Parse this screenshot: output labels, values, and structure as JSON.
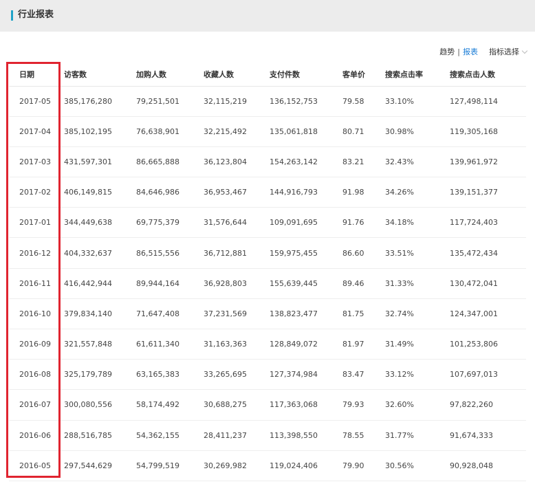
{
  "header": {
    "title": "行业报表"
  },
  "toolbar": {
    "trend_label": "趋势",
    "separator": "|",
    "report_label": "报表",
    "metric_select_label": "指标选择"
  },
  "colors": {
    "accent": "#1fa3c8",
    "link": "#1a7cd6",
    "highlight": "#e02430",
    "header_bg": "#ececec"
  },
  "table": {
    "columns": [
      "日期",
      "访客数",
      "加购人数",
      "收藏人数",
      "支付件数",
      "客单价",
      "搜索点击率",
      "搜索点击人数"
    ],
    "rows": [
      [
        "2017-05",
        "385,176,280",
        "79,251,501",
        "32,115,219",
        "136,152,753",
        "79.58",
        "33.10%",
        "127,498,114"
      ],
      [
        "2017-04",
        "385,102,195",
        "76,638,901",
        "32,215,492",
        "135,061,818",
        "80.71",
        "30.98%",
        "119,305,168"
      ],
      [
        "2017-03",
        "431,597,301",
        "86,665,888",
        "36,123,804",
        "154,263,142",
        "83.21",
        "32.43%",
        "139,961,972"
      ],
      [
        "2017-02",
        "406,149,815",
        "84,646,986",
        "36,953,467",
        "144,916,793",
        "91.98",
        "34.26%",
        "139,151,377"
      ],
      [
        "2017-01",
        "344,449,638",
        "69,775,379",
        "31,576,644",
        "109,091,695",
        "91.76",
        "34.18%",
        "117,724,403"
      ],
      [
        "2016-12",
        "404,332,637",
        "86,515,556",
        "36,712,881",
        "159,975,455",
        "86.60",
        "33.51%",
        "135,472,434"
      ],
      [
        "2016-11",
        "416,442,944",
        "89,944,164",
        "36,928,803",
        "155,639,445",
        "89.46",
        "31.33%",
        "130,472,041"
      ],
      [
        "2016-10",
        "379,834,140",
        "71,647,408",
        "37,231,569",
        "138,823,477",
        "81.75",
        "32.74%",
        "124,347,001"
      ],
      [
        "2016-09",
        "321,557,848",
        "61,611,340",
        "31,163,363",
        "128,849,072",
        "81.97",
        "31.49%",
        "101,253,806"
      ],
      [
        "2016-08",
        "325,179,789",
        "63,165,383",
        "33,265,695",
        "127,374,984",
        "83.47",
        "33.12%",
        "107,697,013"
      ],
      [
        "2016-07",
        "300,080,556",
        "58,174,492",
        "30,688,275",
        "117,363,068",
        "79.93",
        "32.60%",
        "97,822,260"
      ],
      [
        "2016-06",
        "288,516,785",
        "54,362,155",
        "28,411,237",
        "113,398,550",
        "78.55",
        "31.77%",
        "91,674,333"
      ],
      [
        "2016-05",
        "297,544,629",
        "54,799,519",
        "30,269,982",
        "119,024,406",
        "79.90",
        "30.56%",
        "90,928,048"
      ]
    ]
  }
}
